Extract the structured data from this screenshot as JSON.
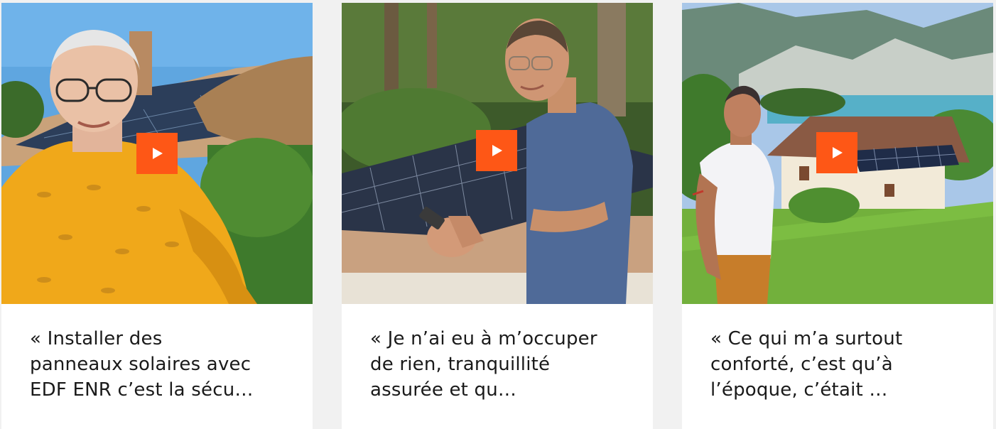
{
  "accent_color": "#fe5716",
  "testimonials": [
    {
      "quote": "« Installer des\npanneaux solaires avec\nEDF ENR c’est la sécu…",
      "thumbnail": "man-glasses-yellow-shirt-solar-roof",
      "play_icon": "play-icon"
    },
    {
      "quote": "« Je n’ai eu à m’occuper\nde rien, tranquillité\nassurée et qu…",
      "thumbnail": "man-blue-shirt-solar-panels-phone",
      "play_icon": "play-icon"
    },
    {
      "quote": "« Ce qui m’a surtout\nconforté, c’est qu’à\nl’époque, c’était …",
      "thumbnail": "man-white-polo-house-lake-mountains",
      "play_icon": "play-icon"
    }
  ]
}
